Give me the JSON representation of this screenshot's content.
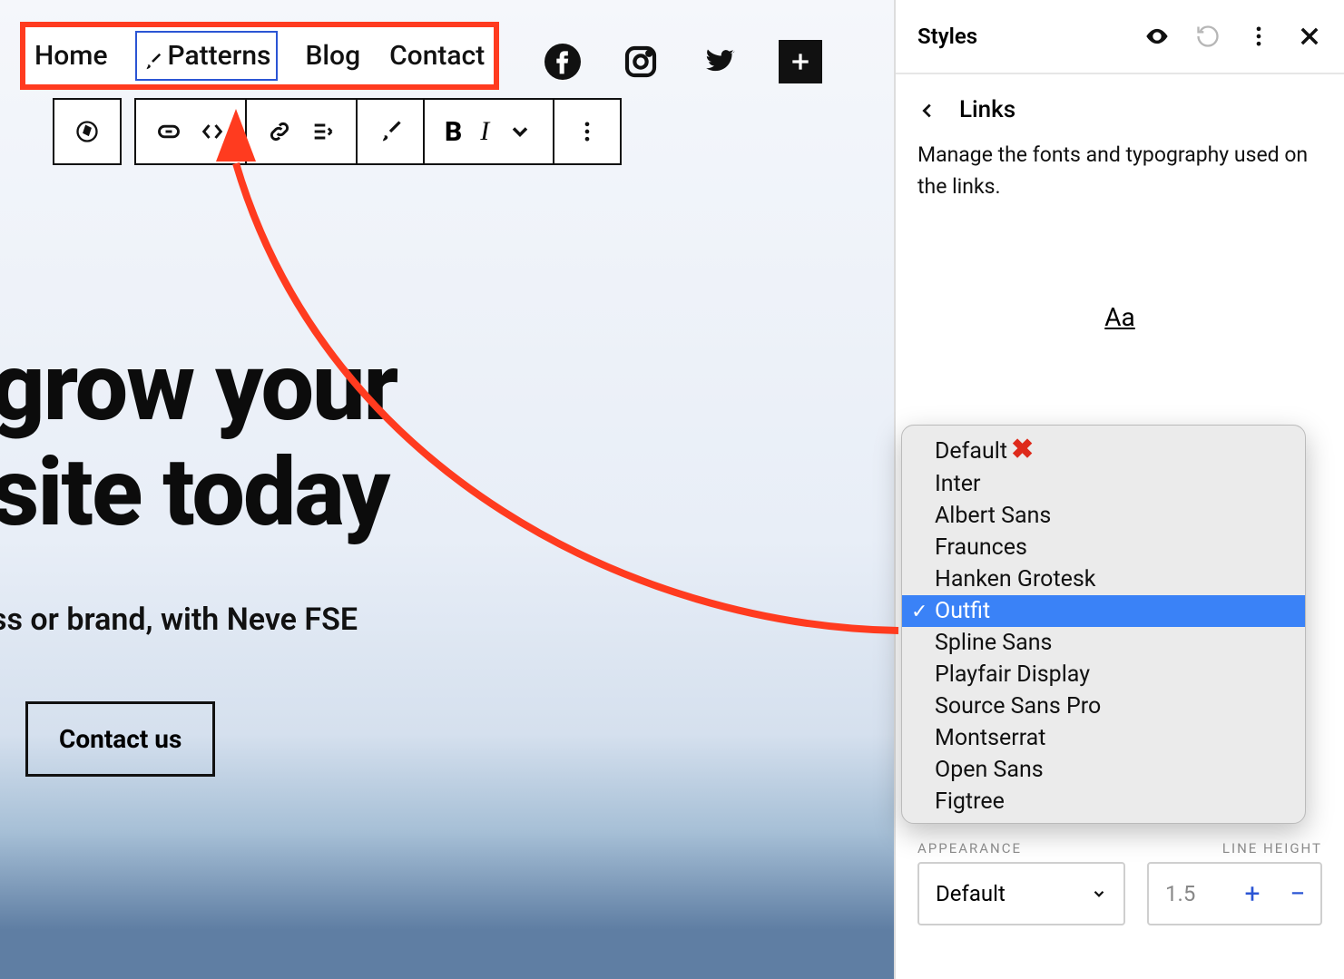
{
  "nav": {
    "items": [
      {
        "label": "Home"
      },
      {
        "label": "Patterns",
        "selected": true
      },
      {
        "label": "Blog"
      },
      {
        "label": "Contact"
      }
    ]
  },
  "hero": {
    "line1": "grow your",
    "line2": "site today",
    "sub": "ss or brand, with Neve FSE",
    "cta": "Contact us"
  },
  "panel": {
    "title": "Styles",
    "section": "Links",
    "description": "Manage the fonts and typography used on the links.",
    "preview": "Aa",
    "appearance_label": "APPEARANCE",
    "lineheight_label": "LINE HEIGHT",
    "appearance_value": "Default",
    "lineheight_value": "1.5"
  },
  "fonts": {
    "options": [
      {
        "label": "Default",
        "x": true
      },
      {
        "label": "Inter"
      },
      {
        "label": "Albert Sans"
      },
      {
        "label": "Fraunces"
      },
      {
        "label": "Hanken Grotesk"
      },
      {
        "label": "Outfit",
        "selected": true
      },
      {
        "label": "Spline Sans"
      },
      {
        "label": "Playfair Display"
      },
      {
        "label": "Source Sans Pro"
      },
      {
        "label": "Montserrat"
      },
      {
        "label": "Open Sans"
      },
      {
        "label": "Figtree"
      }
    ]
  }
}
